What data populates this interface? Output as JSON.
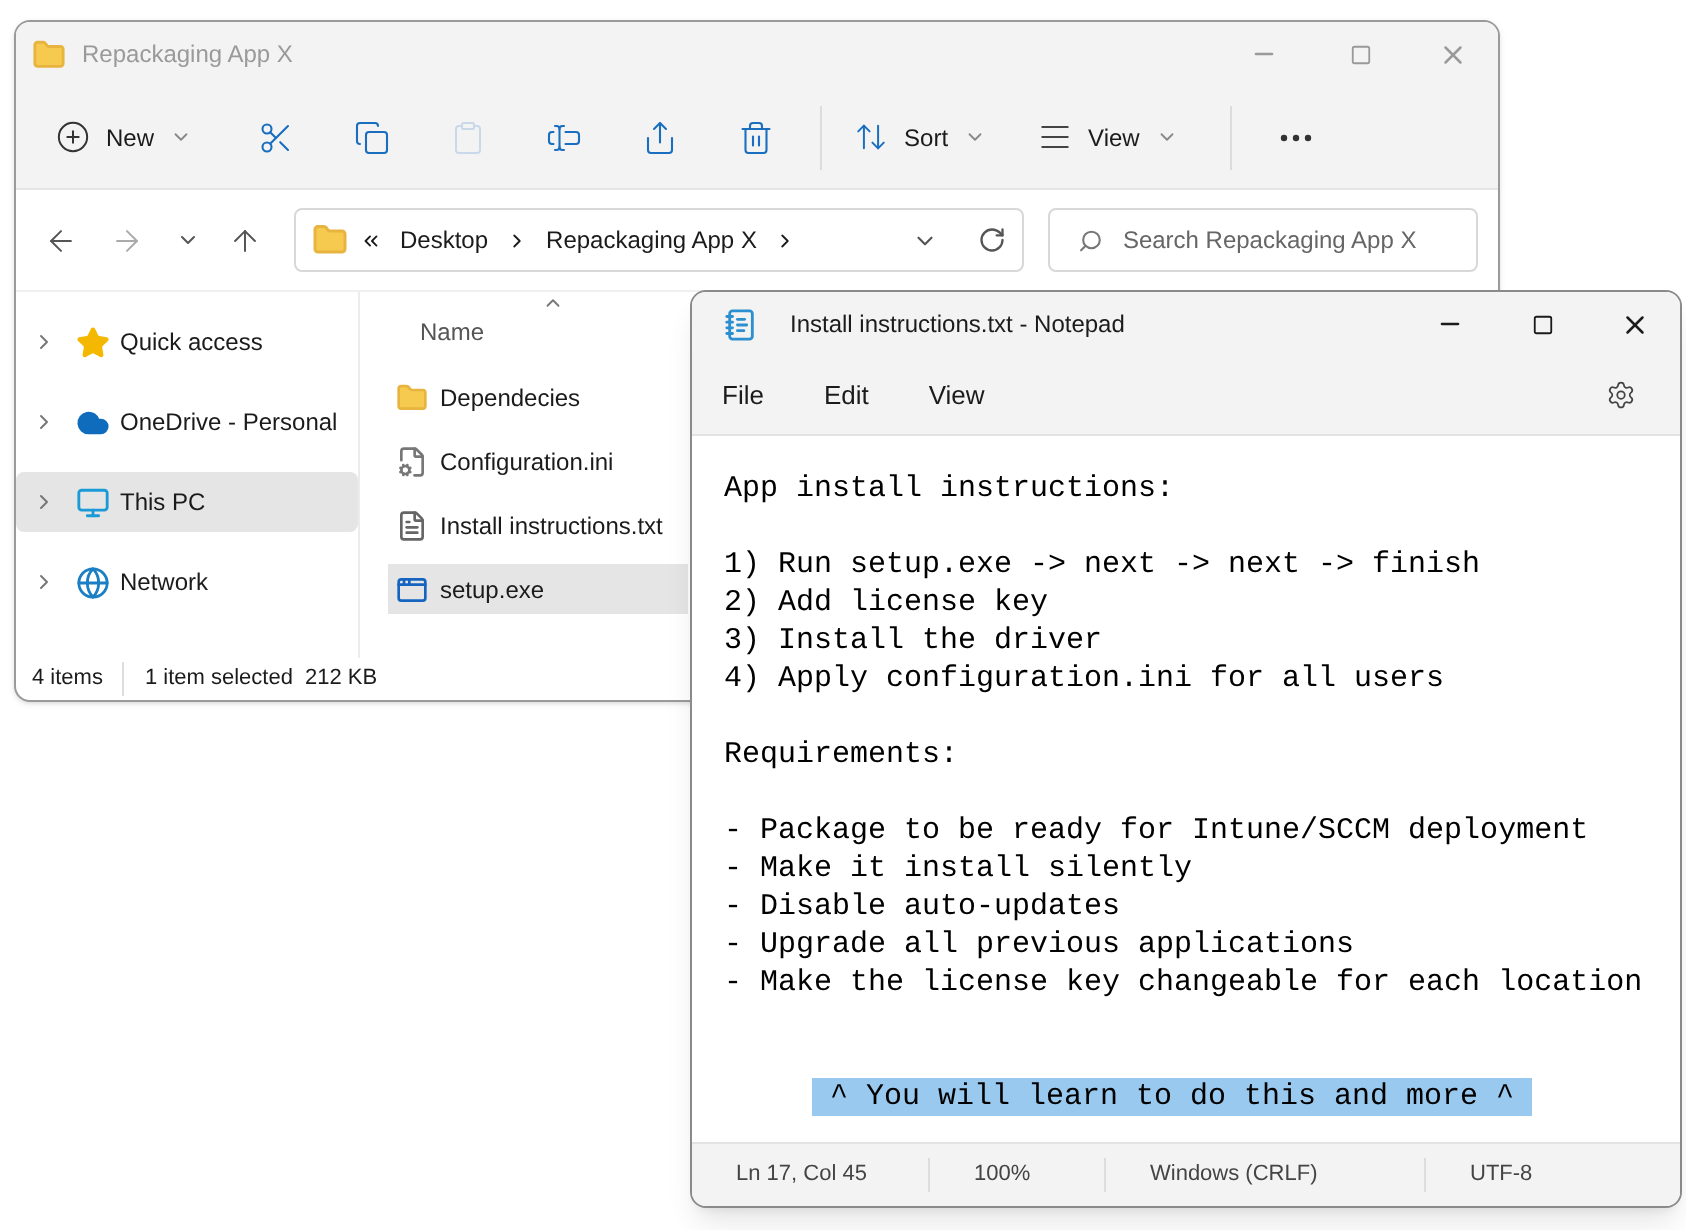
{
  "explorer": {
    "title": "Repackaging App X",
    "toolbar": [
      {
        "kind": "menu",
        "label": "New"
      },
      {
        "kind": "icon",
        "disabled": false
      },
      {
        "kind": "icon",
        "disabled": false
      },
      {
        "kind": "icon",
        "disabled": true
      },
      {
        "kind": "icon",
        "disabled": false
      },
      {
        "kind": "icon",
        "disabled": false
      },
      {
        "kind": "icon",
        "disabled": false
      },
      {
        "kind": "separator"
      },
      {
        "kind": "menu",
        "label": "Sort"
      },
      {
        "kind": "menu",
        "label": "View"
      },
      {
        "kind": "separator"
      },
      {
        "kind": "icon",
        "disabled": false
      }
    ],
    "breadcrumbs": [
      "Desktop",
      "Repackaging App X"
    ],
    "search": {
      "placeholder": "Search Repackaging App X"
    },
    "sidebar": [
      {
        "label": "Quick access",
        "selected": false
      },
      {
        "label": "OneDrive - Personal",
        "selected": false
      },
      {
        "label": "This PC",
        "selected": true
      },
      {
        "label": "Network",
        "selected": false
      }
    ],
    "column": "Name",
    "files": [
      {
        "kind": "folder",
        "name": "Dependecies",
        "selected": false
      },
      {
        "kind": "config",
        "name": "Configuration.ini",
        "selected": false
      },
      {
        "kind": "text",
        "name": "Install instructions.txt",
        "selected": false
      },
      {
        "kind": "app",
        "name": "setup.exe",
        "selected": true
      }
    ],
    "status_bar": [
      "4 items",
      "1 item selected",
      "212 KB"
    ]
  },
  "notepad": {
    "title": "Install instructions.txt - Notepad",
    "menu": [
      "File",
      "Edit",
      "View"
    ],
    "paragraphs": [
      [
        {
          "text": "App install instructions:",
          "selected": false
        }
      ],
      [
        {
          "text": "1) Run setup.exe -> next -> next -> finish",
          "selected": false
        },
        {
          "text": "2) Add license key",
          "selected": false
        },
        {
          "text": "3) Install the driver",
          "selected": false
        },
        {
          "text": "4) Apply configuration.ini for all users",
          "selected": false
        }
      ],
      [
        {
          "text": "Requirements:",
          "selected": false
        }
      ],
      [
        {
          "text": "- Package to be ready for Intune/SCCM deployment",
          "selected": false
        },
        {
          "text": "- Make it install silently",
          "selected": false
        },
        {
          "text": "- Disable auto-updates",
          "selected": false
        },
        {
          "text": "- Upgrade all previous applications",
          "selected": false
        },
        {
          "text": "- Make the license key changeable for each location",
          "selected": false
        }
      ],
      [
        {
          "text": "^ You will learn to do this and more ^",
          "selected": true
        }
      ]
    ],
    "status_bar": [
      "Ln 17, Col 45",
      "100%",
      "Windows (CRLF)",
      "UTF-8"
    ]
  }
}
